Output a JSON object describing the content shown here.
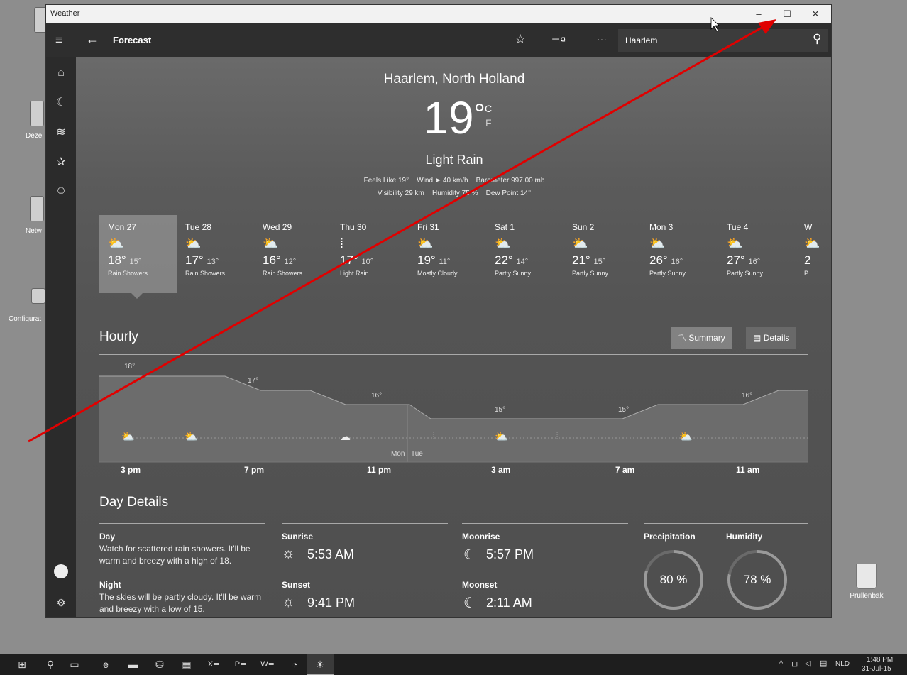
{
  "desktop": {
    "icons": [
      {
        "label": "Deze",
        "icon": "computer-icon"
      },
      {
        "label": "Netw",
        "icon": "network-icon"
      },
      {
        "label": "Configurat",
        "icon": "config-icon"
      },
      {
        "label": "Prullenbak",
        "icon": "recycle-bin-icon"
      }
    ]
  },
  "window": {
    "title": "Weather",
    "controls": {
      "minimize": "–",
      "maximize": "☐",
      "close": "✕"
    }
  },
  "appbar": {
    "page_title": "Forecast",
    "search_value": "Haarlem",
    "icons": [
      "hamburger-icon",
      "back-icon",
      "favorite-icon",
      "pin-icon",
      "more-icon",
      "search-icon"
    ]
  },
  "rail": {
    "icons": [
      "home-icon",
      "maps-icon",
      "historical-icon",
      "places-icon",
      "news-icon",
      "user-avatar-icon",
      "settings-icon"
    ]
  },
  "current": {
    "location": "Haarlem, North Holland",
    "temperature": "19",
    "degree": "°",
    "unit_c": "C",
    "unit_f": "F",
    "condition": "Light Rain",
    "feels_like": "Feels Like  19°",
    "wind": "Wind  ➤ 40 km/h",
    "barometer": "Barometer  997.00 mb",
    "visibility": "Visibility  29 km",
    "humidity": "Humidity  75 %",
    "dew_point": "Dew Point  14°"
  },
  "daily": [
    {
      "day": "Mon 27",
      "high": "18°",
      "low": "15°",
      "cond": "Rain Showers",
      "icon": "sun-rain-icon"
    },
    {
      "day": "Tue 28",
      "high": "17°",
      "low": "13°",
      "cond": "Rain Showers",
      "icon": "sun-rain-icon"
    },
    {
      "day": "Wed 29",
      "high": "16°",
      "low": "12°",
      "cond": "Rain Showers",
      "icon": "sun-rain-icon"
    },
    {
      "day": "Thu 30",
      "high": "17°",
      "low": "10°",
      "cond": "Light Rain",
      "icon": "rain-icon"
    },
    {
      "day": "Fri 31",
      "high": "19°",
      "low": "11°",
      "cond": "Mostly Cloudy",
      "icon": "partly-cloudy-icon"
    },
    {
      "day": "Sat 1",
      "high": "22°",
      "low": "14°",
      "cond": "Partly Sunny",
      "icon": "partly-sunny-icon"
    },
    {
      "day": "Sun 2",
      "high": "21°",
      "low": "15°",
      "cond": "Partly Sunny",
      "icon": "partly-sunny-icon"
    },
    {
      "day": "Mon 3",
      "high": "26°",
      "low": "16°",
      "cond": "Partly Sunny",
      "icon": "partly-sunny-icon"
    },
    {
      "day": "Tue 4",
      "high": "27°",
      "low": "16°",
      "cond": "Partly Sunny",
      "icon": "partly-sunny-icon"
    },
    {
      "day": "W",
      "high": "2",
      "low": "",
      "cond": "P",
      "icon": "partly-sunny-icon"
    }
  ],
  "hourly": {
    "title": "Hourly",
    "summary_label": "Summary",
    "details_label": "Details",
    "temps": [
      "18°",
      "17°",
      "16°",
      "15°",
      "15°",
      "16°"
    ],
    "day_labels": {
      "mon": "Mon",
      "tue": "Tue"
    },
    "times": [
      "3 pm",
      "7 pm",
      "11 pm",
      "3 am",
      "7 am",
      "11 am"
    ]
  },
  "day_details": {
    "title": "Day Details",
    "day_label": "Day",
    "day_text": "Watch for scattered rain showers. It'll be warm and breezy with a high of 18.",
    "night_label": "Night",
    "night_text": "The skies will be partly cloudy. It'll be warm and breezy with a low of 15.",
    "sunrise_label": "Sunrise",
    "sunrise": "5:53 AM",
    "sunset_label": "Sunset",
    "sunset": "9:41 PM",
    "moonrise_label": "Moonrise",
    "moonrise": "5:57 PM",
    "moonset_label": "Moonset",
    "moonset": "2:11 AM",
    "precip_label": "Precipitation",
    "precip": "80 %",
    "precip_value": 0.8,
    "humidity_label": "Humidity",
    "humidity": "78 %",
    "humidity_value": 0.78
  },
  "taskbar": {
    "lang": "NLD",
    "time": "1:48 PM",
    "date": "31-Jul-15"
  },
  "colors": {
    "annotation_arrow": "#e00000"
  }
}
